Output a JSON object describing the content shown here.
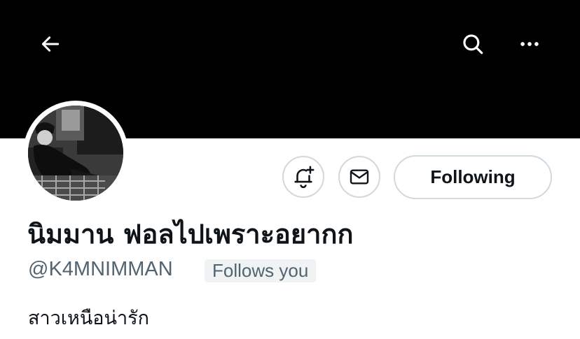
{
  "header": {
    "back_icon": "arrow-left-icon",
    "search_icon": "search-icon",
    "more_icon": "more-horizontal-icon",
    "banner_color": "#000000"
  },
  "profile": {
    "display_name": "นิมมาน ฟอลไปเพราะอยากก",
    "handle": "@K4MNIMMAN",
    "follows_you_label": "Follows you",
    "bio": "สาวเหนือน่ารัก"
  },
  "actions": {
    "notify_icon": "bell-plus-icon",
    "message_icon": "envelope-icon",
    "following_label": "Following"
  }
}
